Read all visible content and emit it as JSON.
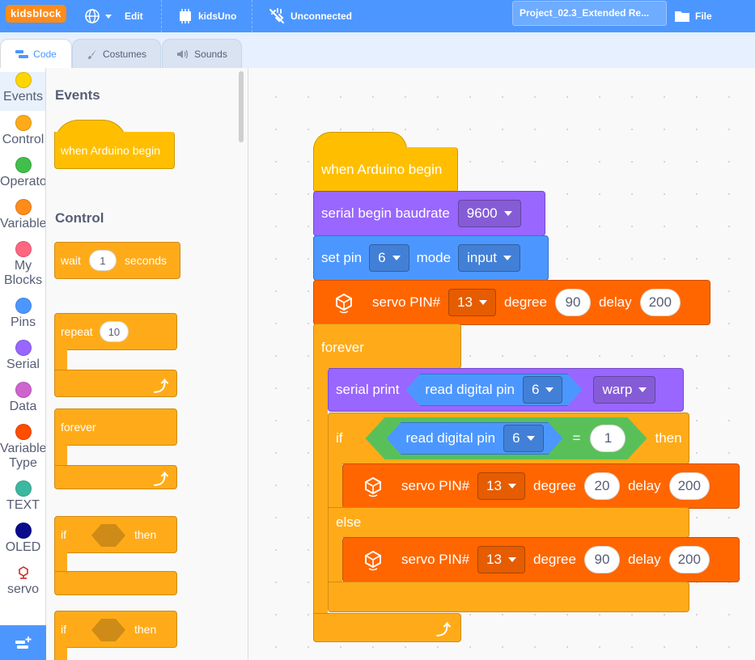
{
  "menubar": {
    "logo": "kidsblock",
    "edit": "Edit",
    "board": "kidsUno",
    "connection": "Unconnected",
    "project_title": "Project_02.3_Extended Re...",
    "file": "File"
  },
  "tabs": [
    {
      "label": "Code"
    },
    {
      "label": "Costumes"
    },
    {
      "label": "Sounds"
    }
  ],
  "categories": [
    {
      "label": "Events",
      "color": "#ffd500"
    },
    {
      "label": "Control",
      "color": "#ffab19"
    },
    {
      "label": "Operator",
      "color": "#40bf4a"
    },
    {
      "label": "Variables",
      "color": "#ff8c1a"
    },
    {
      "label_line1": "My",
      "label_line2": "Blocks",
      "color": "#ff6680"
    },
    {
      "label": "Pins",
      "color": "#4c97ff"
    },
    {
      "label": "Serial",
      "color": "#9966ff"
    },
    {
      "label": "Data",
      "color": "#cf63cf"
    },
    {
      "label_line1": "Variable",
      "label_line2": "Type",
      "color": "#ff4d00"
    },
    {
      "label": "TEXT",
      "color": "#3cb8a0"
    },
    {
      "label": "OLED",
      "color": "#0a0a8c"
    },
    {
      "label": "servo"
    }
  ],
  "palette": {
    "events_heading": "Events",
    "control_heading": "Control",
    "when_arduino_begin": "when Arduino begin",
    "wait_label": "wait",
    "wait_value": "1",
    "wait_unit": "seconds",
    "repeat_label": "repeat",
    "repeat_value": "10",
    "forever_label": "forever",
    "if_label": "if",
    "then_label": "then"
  },
  "script": {
    "hat": "when Arduino begin",
    "serial_begin": {
      "label": "serial begin baudrate",
      "value": "9600"
    },
    "set_pin": {
      "label": "set pin",
      "pin": "6",
      "mode_label": "mode",
      "mode": "input"
    },
    "servo_init": {
      "label": "servo PIN#",
      "pin": "13",
      "degree_label": "degree",
      "degree": "90",
      "delay_label": "delay",
      "delay": "200"
    },
    "forever": "forever",
    "serial_print": {
      "label": "serial print",
      "reporter_label": "read digital pin",
      "reporter_pin": "6",
      "mode": "warp"
    },
    "if_block": {
      "if_label": "if",
      "reporter_label": "read digital pin",
      "reporter_pin": "6",
      "op": "=",
      "compare": "1",
      "then_label": "then",
      "else_label": "else"
    },
    "servo_then": {
      "label": "servo PIN#",
      "pin": "13",
      "degree_label": "degree",
      "degree": "20",
      "delay_label": "delay",
      "delay": "200"
    },
    "servo_else": {
      "label": "servo PIN#",
      "pin": "13",
      "degree_label": "degree",
      "degree": "90",
      "delay_label": "delay",
      "delay": "200"
    }
  }
}
